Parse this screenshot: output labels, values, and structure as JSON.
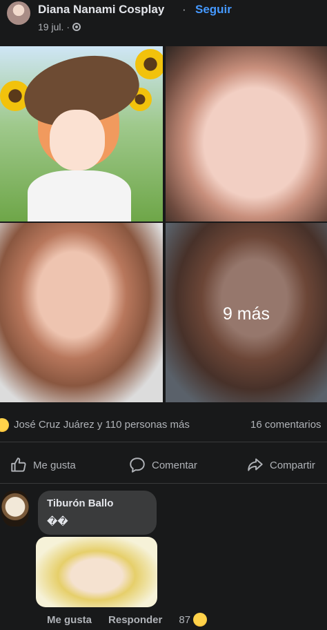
{
  "post": {
    "author": "Diana Nanami Cosplay",
    "separator": "·",
    "follow_label": "Seguir",
    "date": "19 jul.",
    "date_sep": "·",
    "more_photos": "9 más"
  },
  "reactions": {
    "summary": "José Cruz Juárez y 110 personas más",
    "comments": "16 comentarios"
  },
  "actions": {
    "like": "Me gusta",
    "comment": "Comentar",
    "share": "Compartir"
  },
  "comment": {
    "author": "Tiburón Ballo",
    "text": "��",
    "like": "Me gusta",
    "reply": "Responder",
    "count": "87"
  },
  "colors": {
    "background": "#18191a",
    "accent": "#4599ff",
    "secondary_text": "#b0b3b8",
    "bubble": "#3a3b3c"
  }
}
